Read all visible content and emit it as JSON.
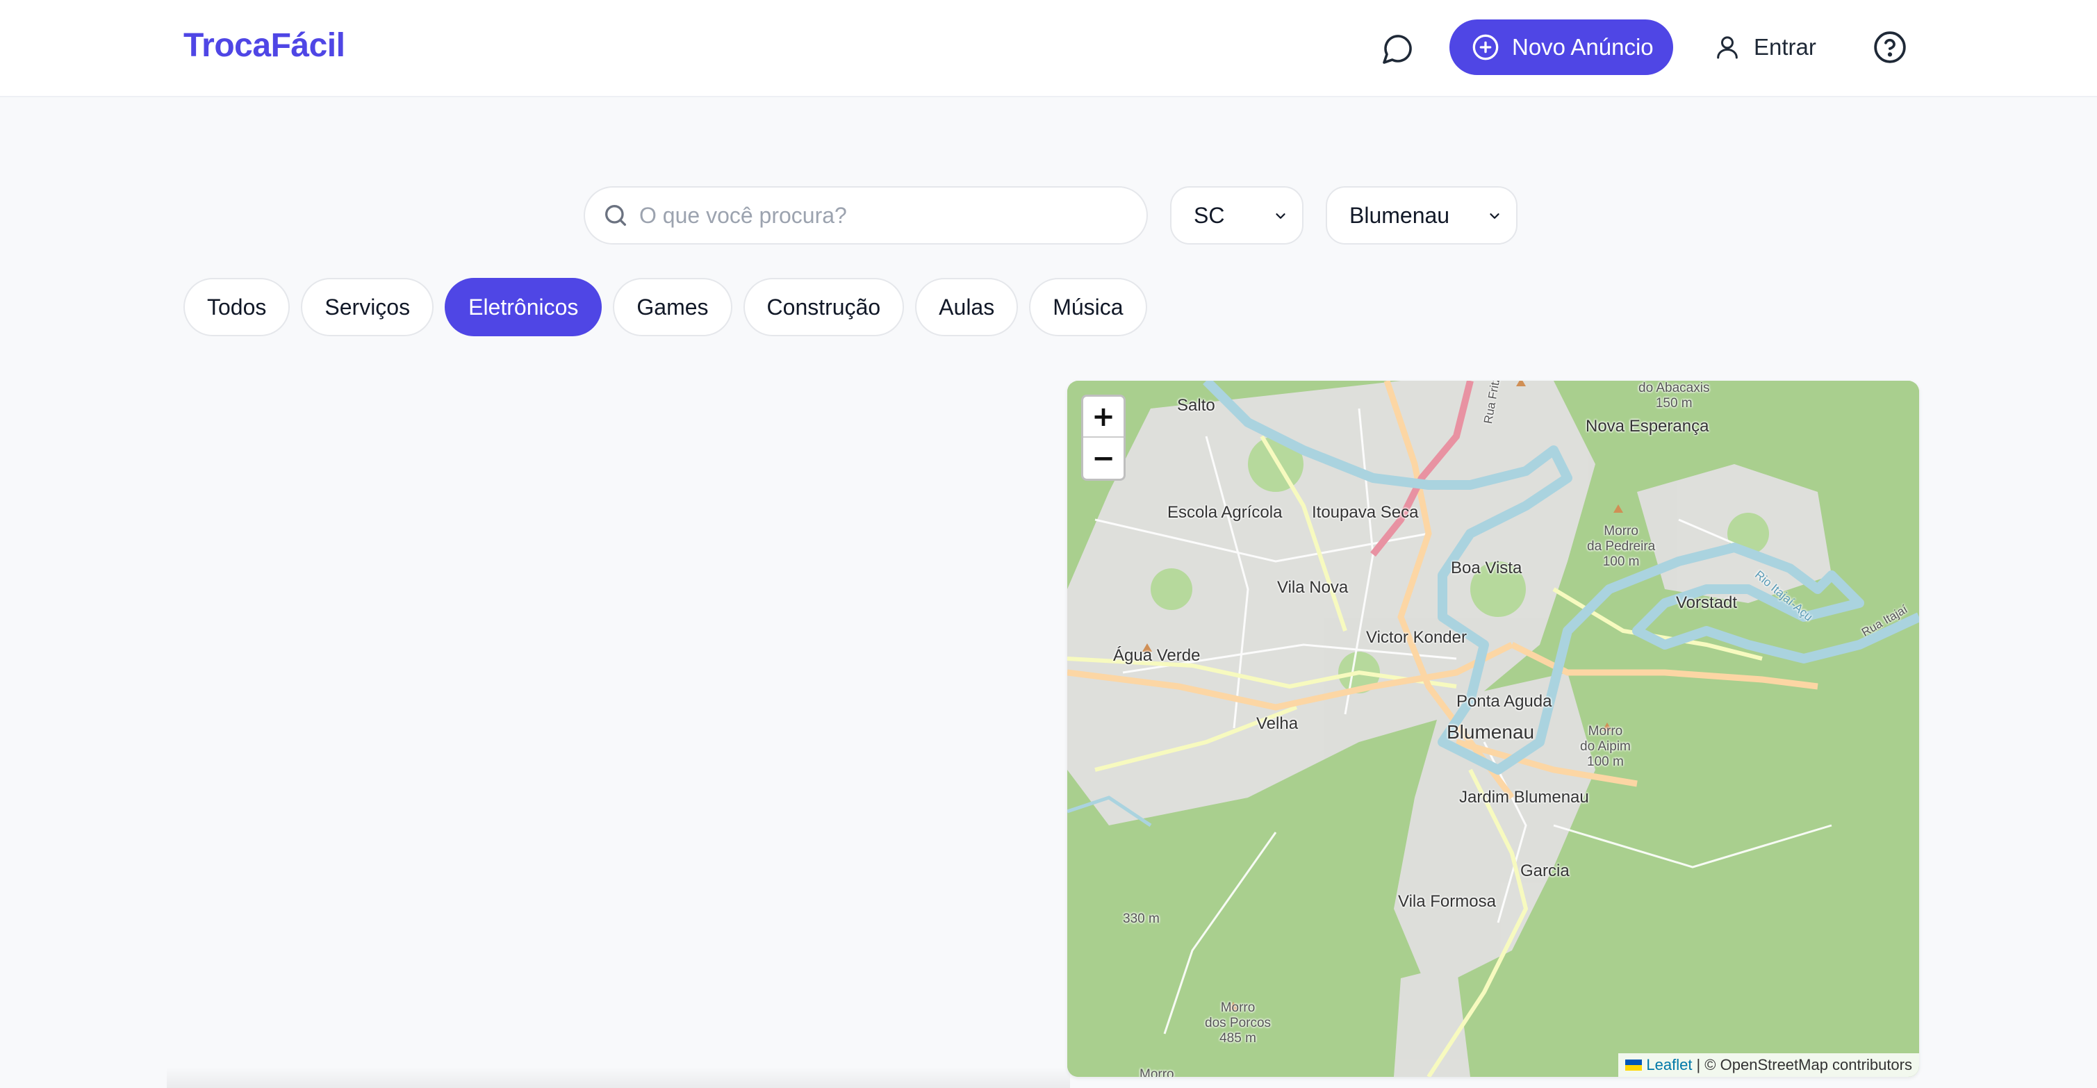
{
  "header": {
    "brand": "TrocaFácil",
    "new_ad_label": "Novo Anúncio",
    "login_label": "Entrar",
    "icons": {
      "chat": "chat-bubble-icon",
      "new_ad": "plus-circle-icon",
      "login": "user-icon",
      "help": "help-circle-icon"
    }
  },
  "search": {
    "placeholder": "O que você procura?",
    "value": "",
    "state_selected": "SC",
    "city_selected": "Blumenau"
  },
  "categories": {
    "items": [
      "Todos",
      "Serviços",
      "Eletrônicos",
      "Games",
      "Construção",
      "Aulas",
      "Música"
    ],
    "active": "Eletrônicos"
  },
  "map": {
    "zoom_in": "+",
    "zoom_out": "−",
    "attribution_link": "Leaflet",
    "attribution_text": "| © OpenStreetMap contributors",
    "places": {
      "salto": "Salto",
      "nova_esperanca": "Nova Esperança",
      "escola_agricola": "Escola Agrícola",
      "itoupava_seca": "Itoupava Seca",
      "boa_vista": "Boa Vista",
      "vila_nova": "Vila Nova",
      "vorstadt": "Vorstadt",
      "victor_konder": "Victor Konder",
      "agua_verde": "Água Verde",
      "ponta_aguda": "Ponta Aguda",
      "blumenau": "Blumenau",
      "velha": "Velha",
      "jardim_blumenau": "Jardim Blumenau",
      "garcia": "Garcia",
      "vila_formosa": "Vila Formosa",
      "rua_fritz_spernau": "Rua Fritz Spernau",
      "rio_itajai_acu": "Rio Itajaí-Açu",
      "rua_itajai": "Rua Itajaí"
    },
    "peaks": {
      "abacaxis": "do Abacaxis\n150 m",
      "pedreira": "Morro\nda Pedreira\n100 m",
      "aipim": "Morro\ndo Aipim\n100 m",
      "p330": "330 m",
      "porcos": "Morro\ndos Porcos\n485 m",
      "morro_bottom": "Morro"
    },
    "colors": {
      "forest": "#a9cf8e",
      "urban": "#e0dfdf",
      "river": "#aad3df",
      "primary_road": "#fcd6a4",
      "secondary_road": "#f7fabf",
      "trunk": "#e892a2"
    }
  },
  "theme": {
    "accent": "#4f46e5",
    "background": "#f8f9fb"
  }
}
